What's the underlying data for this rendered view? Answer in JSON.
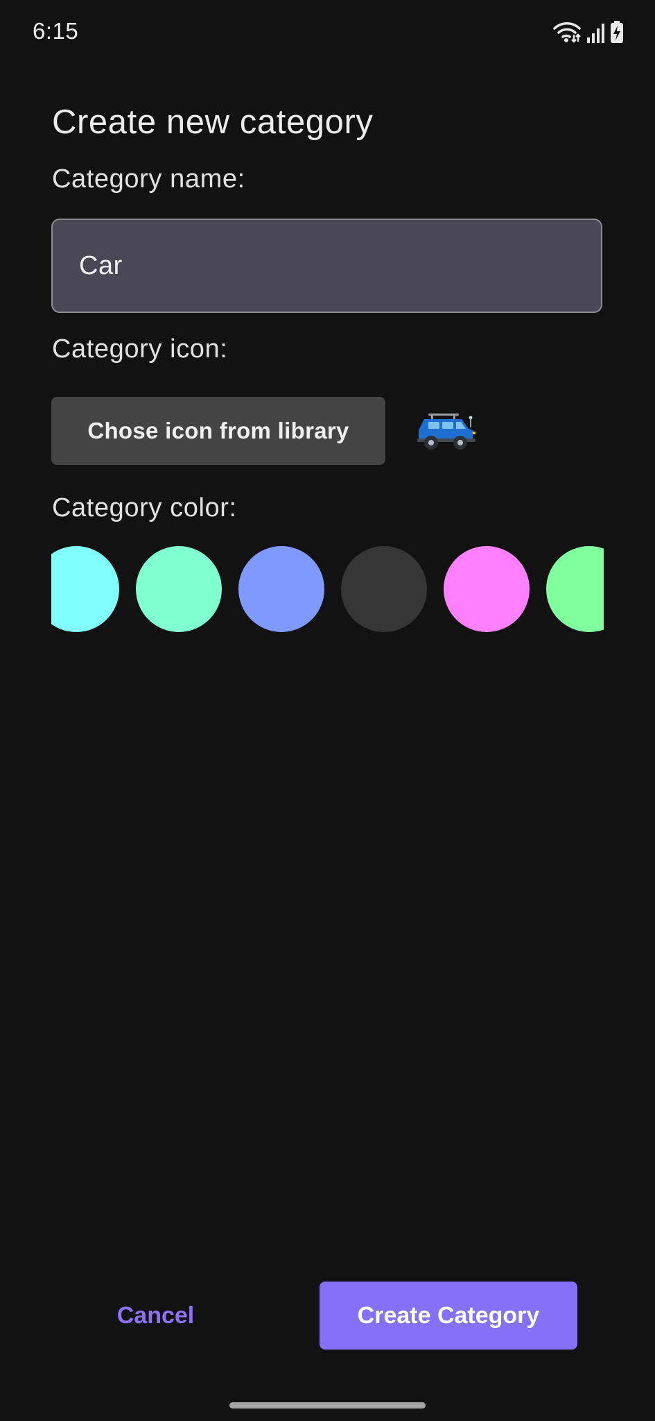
{
  "status_bar": {
    "time": "6:15",
    "icons": [
      "wifi-icon",
      "signal-icon",
      "battery-charging-icon"
    ]
  },
  "dialog": {
    "title": "Create new category",
    "name_label": "Category name:",
    "name_value": "Car",
    "icon_label": "Category icon:",
    "icon_button_label": "Chose icon from library",
    "selected_icon": "car-icon",
    "color_label": "Category color:",
    "colors": [
      "#80ffff",
      "#80ffd0",
      "#8099ff",
      "#363636",
      "#ff80ff",
      "#80ff9f"
    ]
  },
  "actions": {
    "cancel_label": "Cancel",
    "create_label": "Create Category"
  },
  "theme": {
    "accent": "#8570f7",
    "background": "#121212"
  }
}
